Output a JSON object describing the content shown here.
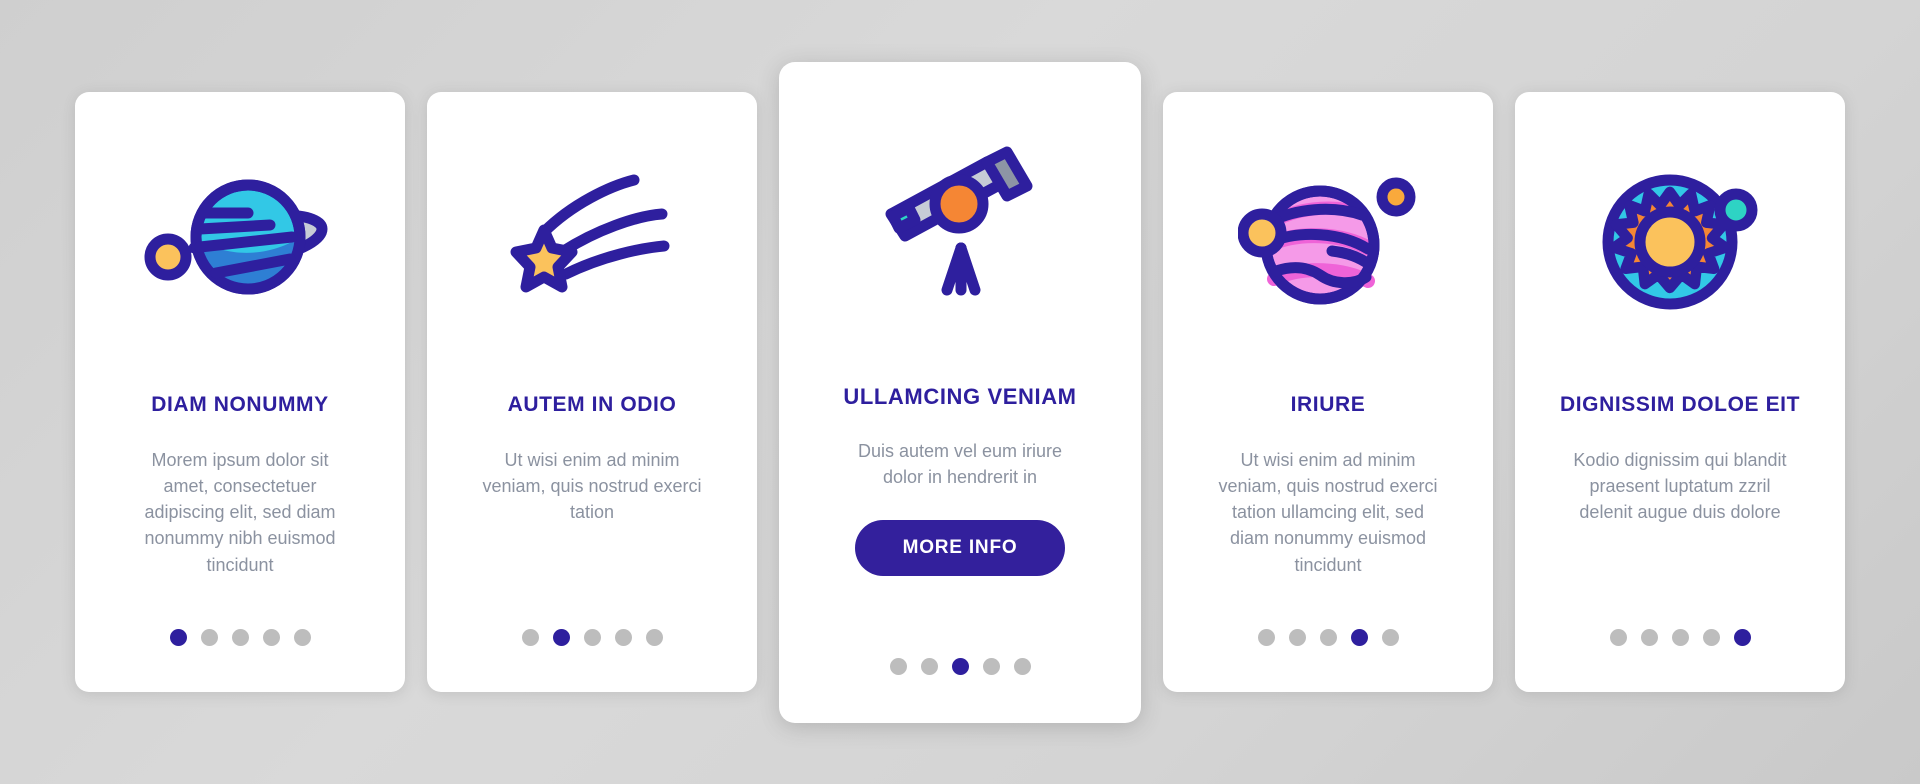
{
  "background": {
    "color_start": "#cfcfcf",
    "color_end": "#c9c9c9"
  },
  "palette": {
    "deep_purple": "#2e1f9e",
    "button_purple": "#33209c",
    "body_gray": "#8b92a0",
    "dot_inactive": "#bdbdbd",
    "cyan": "#32c8e6",
    "blue": "#2e7fd4",
    "yellow": "#fbc25c",
    "orange": "#f58634",
    "pink": "#f59ae8",
    "pink_dark": "#ef63d8",
    "gray_body": "#c7ccd6",
    "gray_dark": "#8d95a5",
    "teal": "#2ed3c4",
    "card_bg": "#ffffff"
  },
  "cards": [
    {
      "icon": "saturn-planet-icon",
      "title": "DIAM NONUMMY",
      "description": "Morem ipsum dolor sit amet, consectetuer adipiscing elit, sed diam nonummy nibh euismod tincidunt",
      "featured": false,
      "cta": null,
      "dots": {
        "count": 5,
        "active": 0
      }
    },
    {
      "icon": "shooting-star-icon",
      "title": "AUTEM IN ODIO",
      "description": "Ut wisi enim ad minim veniam, quis nostrud exerci tation",
      "featured": false,
      "cta": null,
      "dots": {
        "count": 5,
        "active": 1
      }
    },
    {
      "icon": "telescope-icon",
      "title": "ULLAMCING VENIAM",
      "description": "Duis autem vel eum iriure dolor in hendrerit in",
      "featured": true,
      "cta": "MORE INFO",
      "dots": {
        "count": 5,
        "active": 2
      }
    },
    {
      "icon": "pink-planet-moons-icon",
      "title": "IRIURE",
      "description": "Ut wisi enim ad minim veniam, quis nostrud exerci tation ullamcing elit, sed diam nonummy euismod tincidunt",
      "featured": false,
      "cta": null,
      "dots": {
        "count": 5,
        "active": 3
      }
    },
    {
      "icon": "sun-orbit-icon",
      "title": "DIGNISSIM DOLOE EIT",
      "description": "Kodio dignissim qui blandit praesent luptatum zzril delenit augue duis dolore",
      "featured": false,
      "cta": null,
      "dots": {
        "count": 5,
        "active": 4
      }
    }
  ]
}
